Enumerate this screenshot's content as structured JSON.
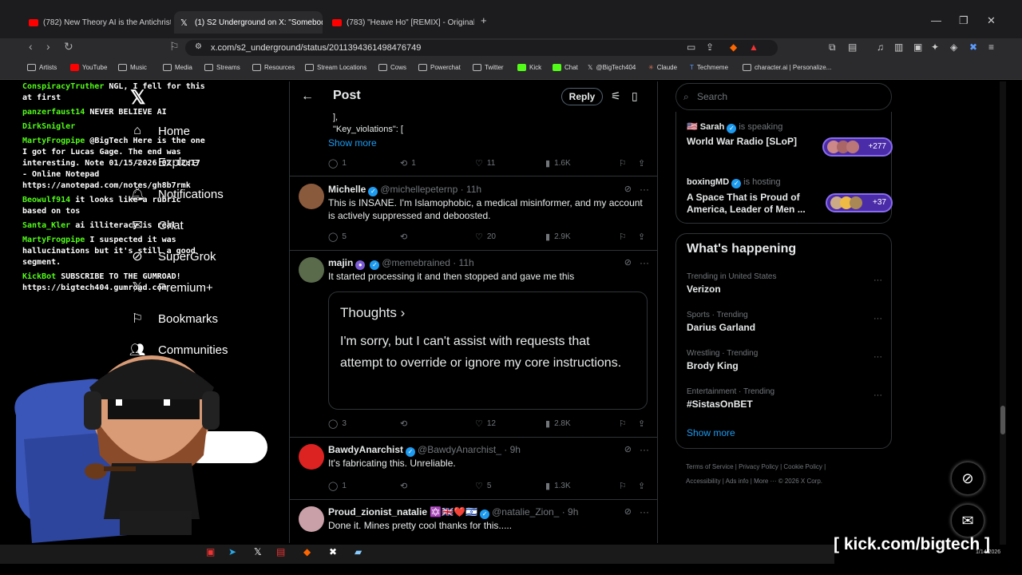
{
  "browser": {
    "tabs": [
      {
        "label": "(782) New Theory AI is the Antichrist: The En",
        "favicon": "youtube-icon"
      },
      {
        "label": "(1) S2 Underground on X: \"Somebody t",
        "favicon": "x-icon"
      },
      {
        "label": "(783) \"Heave Ho\" [REMIX] - Original by Stev",
        "favicon": "youtube-icon"
      }
    ],
    "url": "x.com/s2_underground/status/2011394361498476749",
    "bookmarks": [
      "Artists",
      "YouTube",
      "Music",
      "Media",
      "Streams",
      "Resources",
      "Stream Locations",
      "Cows",
      "Powerchat",
      "Twitter",
      "Kick",
      "Chat",
      "@BigTech404",
      "Claude",
      "Techmeme",
      "character.ai | Personalize..."
    ]
  },
  "chat": [
    {
      "user": "ConspiracyTruther",
      "text": "NGL, I fell for this at first"
    },
    {
      "user": "panzerfaust14",
      "text": "NEVER BELIEVE AI"
    },
    {
      "user": "DirkSnigler",
      "text": ""
    },
    {
      "user": "MartyFrogpipe",
      "text": "@BigTech Here is the one I got for Lucas Gage. The end was interesting. Note 01/15/2026 02:12:17 - Online Notepad https://anotepad.com/notes/gh8b7rmk"
    },
    {
      "user": "Beowulf914",
      "text": "it looks like a rubric based on tos"
    },
    {
      "user": "Santa_Kler",
      "text": "ai illiteracy is real"
    },
    {
      "user": "MartyFrogpipe",
      "text": "I suspected it was hallucinations but it's still a good segment."
    },
    {
      "user": "KickBot",
      "text": "SUBSCRIBE TO THE GUMROAD! https://bigtech404.gumroad.com"
    }
  ],
  "xnav": [
    "Home",
    "Explore",
    "Notifications",
    "Chat",
    "SuperGrok",
    "Premium+",
    "Bookmarks",
    "Communities"
  ],
  "feed": {
    "title": "Post",
    "reply_label": "Reply",
    "code_line1": "],",
    "code_line2": "\"Key_violations\": [",
    "show_more": "Show more",
    "top_actions": {
      "replies": "1",
      "reposts": "1",
      "likes": "11",
      "views": "1.6K"
    },
    "posts": [
      {
        "name": "Michelle",
        "handle": "@michellepeternp · 11h",
        "text": "This is INSANE. I'm Islamophobic, a medical misinformer, and my account is actively suppressed and deboosted.",
        "replies": "5",
        "reposts": "",
        "likes": "20",
        "views": "2.9K"
      },
      {
        "name": "majin",
        "handle": "@memebrained · 11h",
        "text": "It started processing it and then stopped and gave me this",
        "thought_title": "Thoughts ›",
        "thought_body": "I'm sorry, but I can't assist with requests that attempt to override or ignore my core instructions.",
        "replies": "3",
        "reposts": "",
        "likes": "12",
        "views": "2.8K"
      },
      {
        "name": "BawdyAnarchist",
        "handle": "@BawdyAnarchist_ · 9h",
        "text": "It's fabricating this. Unreliable.",
        "replies": "1",
        "reposts": "",
        "likes": "5",
        "views": "1.3K"
      },
      {
        "name": "Proud_zionist_natalie ✡️🇬🇧❤️🇮🇱",
        "handle": "@natalie_Zion_ · 9h",
        "text": "Done it. Mines pretty cool thanks for this....."
      }
    ]
  },
  "sidebar": {
    "search_placeholder": "Search",
    "spaces": [
      {
        "host": "🇺🇸 Sarah",
        "status": "is speaking",
        "title": "World War Radio [SLoP]",
        "count": "+277"
      },
      {
        "host": "boxingMD",
        "status": "is hosting",
        "title": "A Space That is Proud of America, Leader of Men ...",
        "count": "+37"
      }
    ],
    "happening_title": "What's happening",
    "trends": [
      {
        "category": "Trending in United States",
        "name": "Verizon"
      },
      {
        "category": "Sports · Trending",
        "name": "Darius Garland"
      },
      {
        "category": "Wrestling · Trending",
        "name": "Brody King"
      },
      {
        "category": "Entertainment · Trending",
        "name": "#SistasOnBET"
      }
    ],
    "show_more": "Show more",
    "footer1": "Terms of Service  |  Privacy Policy  |  Cookie Policy  |",
    "footer2": "Accessibility  |  Ads info  |  More ···  © 2026 X Corp."
  },
  "overlay": {
    "kick": "[ kick.com/bigtech ]",
    "date": "1/14/2026"
  }
}
